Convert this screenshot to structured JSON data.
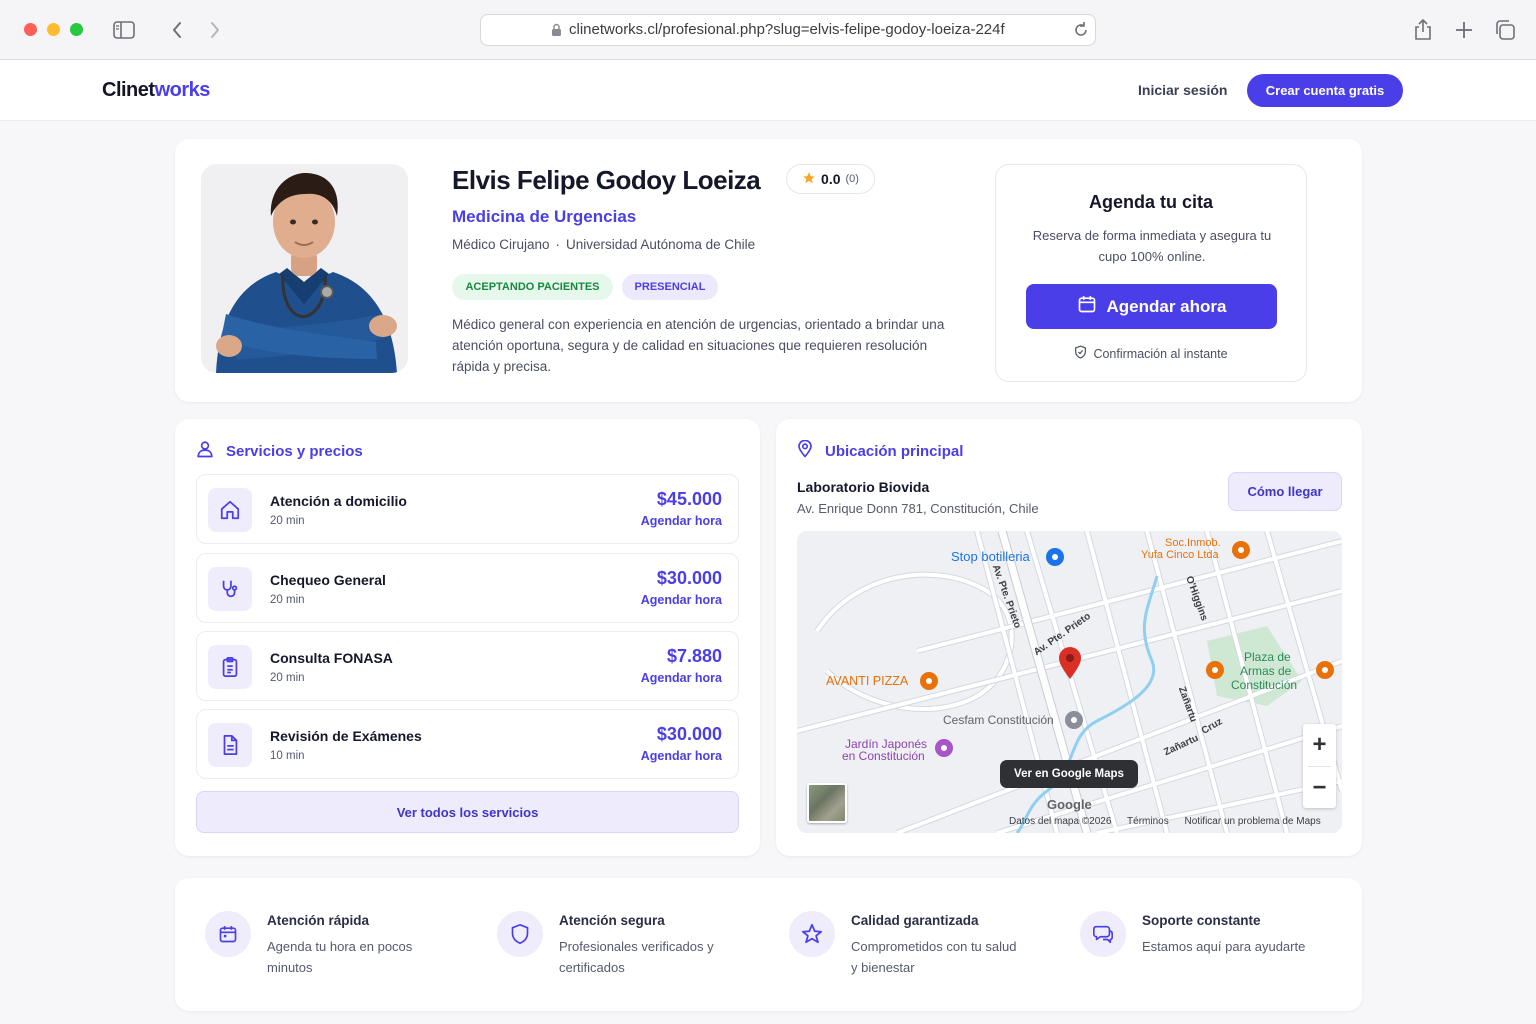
{
  "browser": {
    "url": "clinetworks.cl/profesional.php?slug=elvis-felipe-godoy-loeiza-224f"
  },
  "header": {
    "logo_part1": "Clinet",
    "logo_part2": "works",
    "login_label": "Iniciar sesión",
    "signup_label": "Crear cuenta gratis"
  },
  "profile": {
    "name": "Elvis Felipe Godoy Loeiza",
    "rating": "0.0",
    "rating_count": "(0)",
    "specialty": "Medicina de Urgencias",
    "title": "Médico Cirujano",
    "separator": "·",
    "university": "Universidad Autónoma de Chile",
    "badges": [
      "ACEPTANDO PACIENTES",
      "PRESENCIAL"
    ],
    "bio": "Médico general con experiencia en atención de urgencias, orientado a brindar una atención oportuna, segura y de calidad en situaciones que requieren resolución rápida y precisa."
  },
  "booking": {
    "title": "Agenda tu cita",
    "subtitle": "Reserva de forma inmediata y asegura tu cupo 100% online.",
    "button_label": "Agendar ahora",
    "confirmation": "Confirmación al instante"
  },
  "services": {
    "title": "Servicios y precios",
    "book_label": "Agendar hora",
    "items": [
      {
        "name": "Atención a domicilio",
        "duration": "20 min",
        "price": "$45.000",
        "icon": "home-icon"
      },
      {
        "name": "Chequeo General",
        "duration": "20 min",
        "price": "$30.000",
        "icon": "stethoscope-icon"
      },
      {
        "name": "Consulta FONASA",
        "duration": "20 min",
        "price": "$7.880",
        "icon": "clipboard-icon"
      },
      {
        "name": "Revisión de Exámenes",
        "duration": "10 min",
        "price": "$30.000",
        "icon": "document-icon"
      }
    ],
    "see_all_label": "Ver todos los servicios"
  },
  "location": {
    "title": "Ubicación principal",
    "place_name": "Laboratorio Biovida",
    "address": "Av. Enrique Donn 781, Constitución, Chile",
    "directions_label": "Cómo llegar",
    "map": {
      "labels": {
        "stop": "Stop botilleria",
        "soc1": "Soc.Inmob.",
        "soc2": "Yufa Cinco Ltda",
        "avanti": "AVANTI PIZZA",
        "plaza1": "Plaza de",
        "plaza2": "Armas de",
        "plaza3": "Constitución",
        "cesfam": "Cesfam Constitución",
        "jardin1": "Jardín Japonés",
        "jardin2": "en Constitución",
        "street_prieto": "Av. Pte. Prieto",
        "street_prieto2": "Av. Pte. Prieto",
        "street_oheggins": "O'Higgins",
        "street_zanartu": "Zañartu",
        "street_cruz": "Cruz",
        "street_zanartu2": "Zañartu"
      },
      "google_maps_button": "Ver en Google Maps",
      "google_logo": "Google",
      "attribution": [
        "Datos del mapa ©2026",
        "Términos",
        "Notificar un problema de Maps"
      ],
      "zoom_in": "+",
      "zoom_out": "−"
    }
  },
  "features": [
    {
      "title": "Atención rápida",
      "desc": "Agenda tu hora en pocos minutos",
      "icon": "calendar-icon"
    },
    {
      "title": "Atención segura",
      "desc": "Profesionales verificados y certificados",
      "icon": "shield-icon"
    },
    {
      "title": "Calidad garantizada",
      "desc": "Comprometidos con tu salud y bienestar",
      "icon": "star-icon"
    },
    {
      "title": "Soporte constante",
      "desc": "Estamos aquí para ayudarte",
      "icon": "chat-icon"
    }
  ],
  "colors": {
    "accent": "#4a3ee8",
    "badge_green_text": "#17893f",
    "badge_green_bg": "#e6f7ec",
    "map_pin": "#d93025",
    "map_poi_orange": "#e8710a",
    "map_poi_blue": "#1a73e8",
    "map_poi_purple": "#8e44ad"
  }
}
